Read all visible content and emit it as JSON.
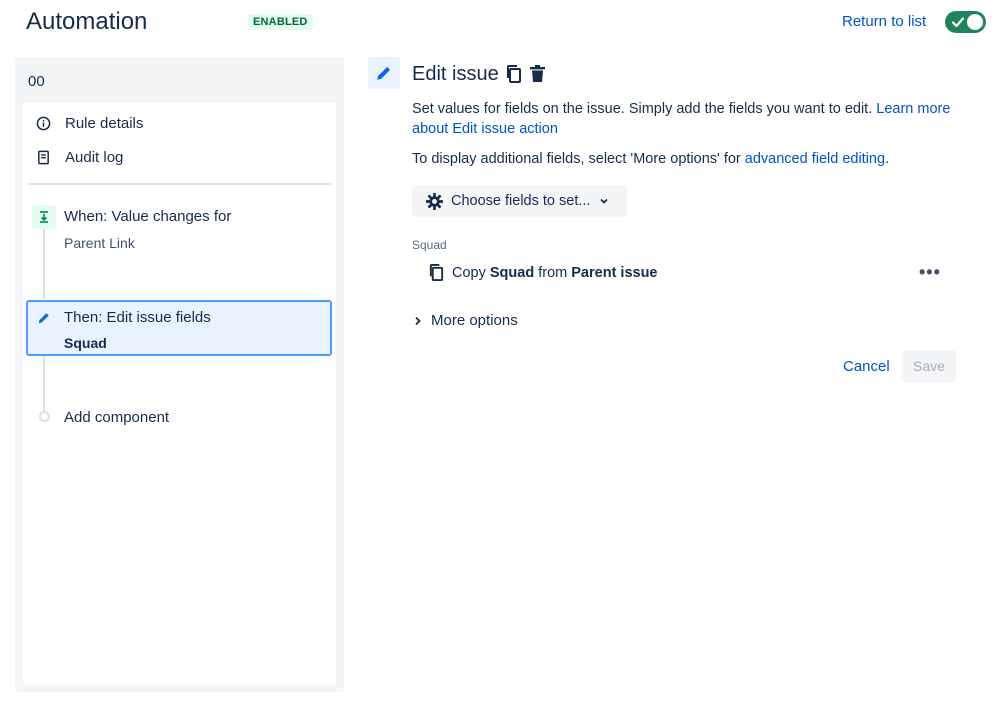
{
  "header": {
    "title": "Automation",
    "status": "ENABLED",
    "return_link": "Return to list",
    "toggle_state": "on"
  },
  "sidebar": {
    "rule_name": "00",
    "nav": [
      {
        "label": "Rule details",
        "icon": "info-icon"
      },
      {
        "label": "Audit log",
        "icon": "audit-log-icon"
      }
    ],
    "trigger": {
      "title": "When: Value changes for",
      "subtitle": "Parent Link",
      "icon": "trigger-icon"
    },
    "action": {
      "title": "Then: Edit issue fields",
      "subtitle": "Squad",
      "icon": "pencil-icon"
    },
    "add_component": "Add component"
  },
  "panel": {
    "title": "Edit issue",
    "description": "Set values for fields on the issue. Simply add the fields you want to edit.",
    "learn_more": "Learn more about Edit issue action",
    "more_fields_text": "To display additional fields, select 'More options' for",
    "advanced_link": "advanced field editing",
    "choose_button": "Choose fields to set...",
    "field": {
      "label": "Squad",
      "copy_prefix": "Copy",
      "field_name": "Squad",
      "from_text": "from",
      "source": "Parent issue"
    },
    "more_options": "More options",
    "cancel": "Cancel",
    "save": "Save"
  },
  "colors": {
    "accent": "#0052cc",
    "enabled_bg": "#e3fcef",
    "enabled_text": "#006644",
    "toggle_on": "#1f845a",
    "selected_border": "#4c9aff"
  }
}
